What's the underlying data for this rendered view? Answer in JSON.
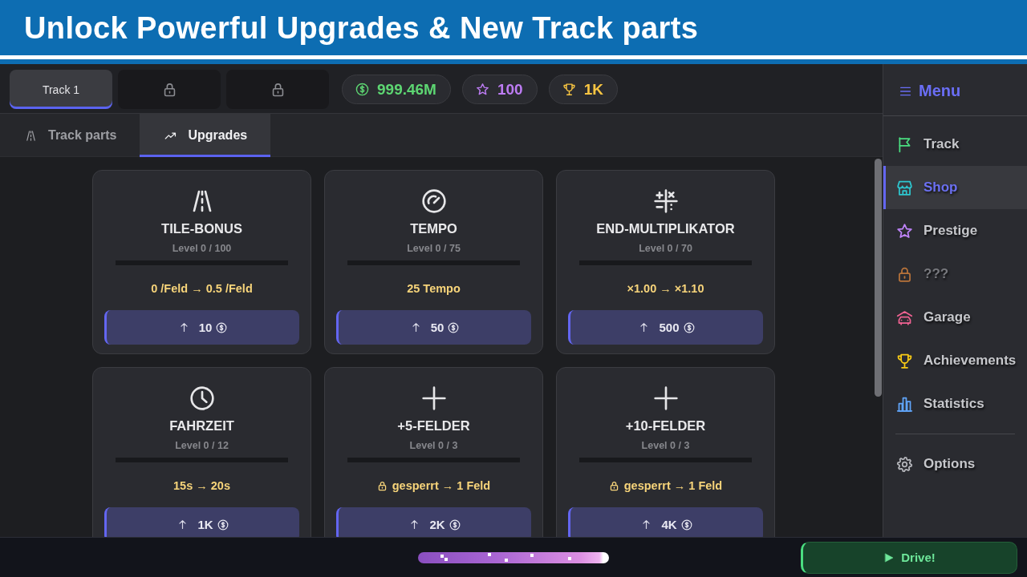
{
  "banner": {
    "title": "Unlock Powerful Upgrades & New Track parts"
  },
  "track_tabs": [
    {
      "label": "Track 1",
      "selected": true,
      "locked": false
    },
    {
      "selected": false,
      "locked": true
    },
    {
      "selected": false,
      "locked": true
    }
  ],
  "balance": {
    "money": "999.46M",
    "stars": "100",
    "trophies": "1K"
  },
  "section_tabs": [
    {
      "label": "Track parts",
      "selected": false
    },
    {
      "label": "Upgrades",
      "selected": true
    }
  ],
  "upgrades": [
    {
      "title": "TILE-BONUS",
      "level_text": "Level 0 / 100",
      "level": 0,
      "effect": "0 /Feld → 0.5 /Feld",
      "locked": false,
      "cost": "10"
    },
    {
      "title": "TEMPO",
      "level_text": "Level 0 / 75",
      "level": 0,
      "effect": "25 Tempo",
      "locked": false,
      "cost": "50"
    },
    {
      "title": "END-MULTIPLIKATOR",
      "level_text": "Level 0 / 70",
      "level": 0,
      "effect": "×1.00 → ×1.10",
      "locked": false,
      "cost": "500"
    },
    {
      "title": "FAHRZEIT",
      "level_text": "Level 0 / 12",
      "level": 0,
      "effect": "15s → 20s",
      "locked": false,
      "cost": "1K"
    },
    {
      "title": "+5-FELDER",
      "level_text": "Level 0 / 3",
      "level": 0,
      "effect": "gesperrt → 1 Feld",
      "locked": true,
      "cost": "2K"
    },
    {
      "title": "+10-FELDER",
      "level_text": "Level 0 / 3",
      "level": 0,
      "effect": "gesperrt → 1 Feld",
      "locked": true,
      "cost": "4K"
    }
  ],
  "menu": {
    "title": "Menu",
    "items": [
      {
        "label": "Track",
        "color": "#4ade80",
        "selected": false,
        "disabled": false
      },
      {
        "label": "Shop",
        "color": "#2dc7d0",
        "selected": true,
        "disabled": false
      },
      {
        "label": "Prestige",
        "color": "#c084fc",
        "selected": false,
        "disabled": false
      },
      {
        "label": "???",
        "color": "#b8733a",
        "selected": false,
        "disabled": true
      },
      {
        "label": "Garage",
        "color": "#f06292",
        "selected": false,
        "disabled": false
      },
      {
        "label": "Achievements",
        "color": "#facc15",
        "selected": false,
        "disabled": false
      },
      {
        "label": "Statistics",
        "color": "#60a5fa",
        "selected": false,
        "disabled": false
      }
    ],
    "footer_items": [
      {
        "label": "Options",
        "color": "#b4b5ba",
        "selected": false,
        "disabled": false
      }
    ]
  },
  "bottom_bar": {
    "drive_button": "Drive!"
  }
}
